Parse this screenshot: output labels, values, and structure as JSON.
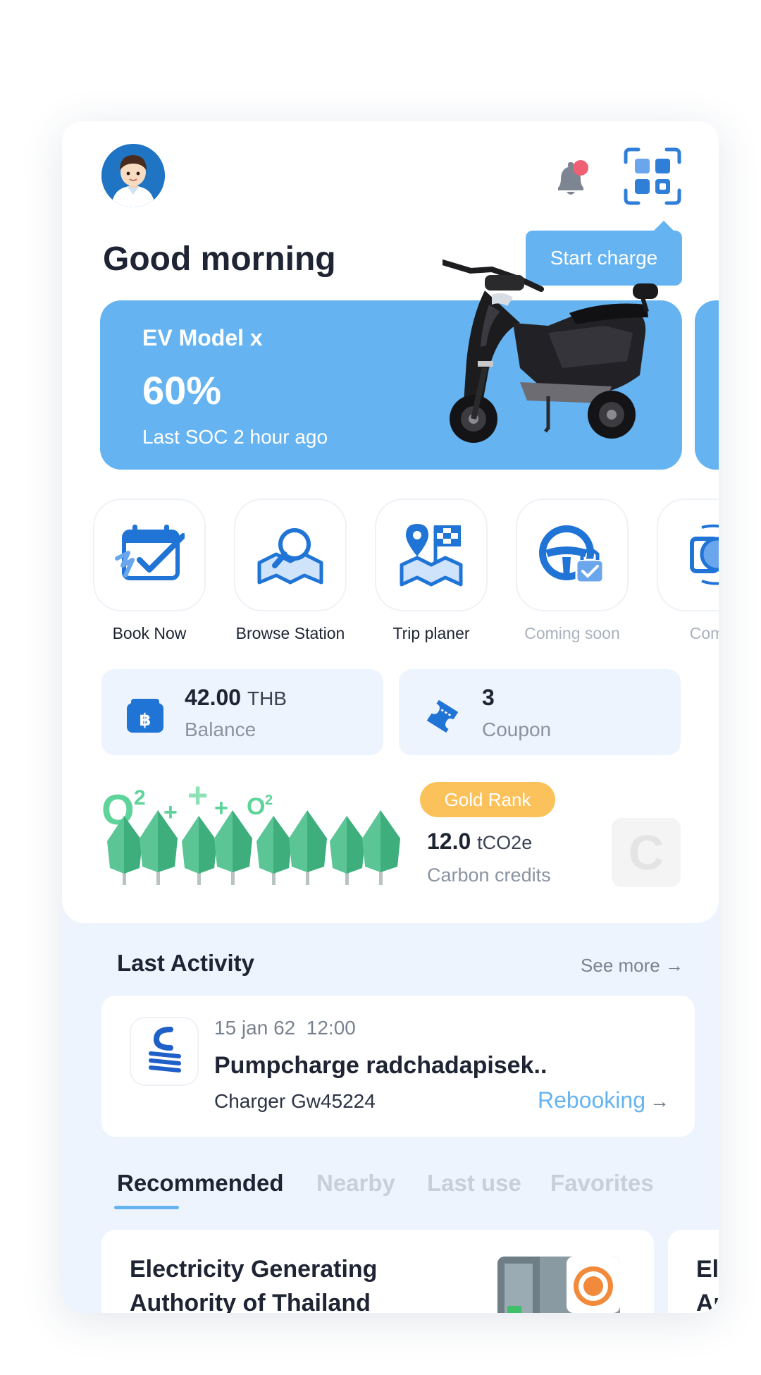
{
  "header": {
    "greeting": "Good morning",
    "tooltip": "Start charge",
    "avatar_icon": "user-avatar",
    "bell_icon": "bell-icon",
    "qr_icon": "qr-scan-icon"
  },
  "ev_card": {
    "model": "EV Model x",
    "soc": "60%",
    "last_update": "Last SOC 2 hour ago"
  },
  "quick_actions": [
    {
      "label": "Book Now",
      "icon": "calendar-check-icon"
    },
    {
      "label": "Browse Station",
      "icon": "map-search-icon"
    },
    {
      "label": "Trip planer",
      "icon": "trip-map-flag-icon"
    },
    {
      "label": "Coming soon",
      "icon": "steering-lock-icon"
    },
    {
      "label": "Comin",
      "icon": "partial-icon"
    }
  ],
  "balance": {
    "value": "42.00",
    "unit": "THB",
    "label": "Balance",
    "icon": "wallet-baht-icon"
  },
  "coupon": {
    "value": "3",
    "label": "Coupon",
    "icon": "ticket-icon"
  },
  "carbon": {
    "rank": "Gold Rank",
    "value": "12.0",
    "unit": "tCO2e",
    "label": "Carbon credits"
  },
  "last_activity": {
    "title": "Last Activity",
    "see_more": "See more",
    "date": "15 jan 62  12:00",
    "station": "Pumpcharge radchadapisek..",
    "charger": "Charger Gw45224",
    "action": "Rebooking"
  },
  "tabs": [
    "Recommended",
    "Nearby",
    "Last use",
    "Favorites"
  ],
  "recommended": {
    "title": "Electricity Generating Authority of Thailand",
    "peek_title_1": "El",
    "peek_title_2": "Au"
  },
  "colors": {
    "accent": "#65b3f1",
    "icon_blue": "#1f74d6",
    "gold": "#fbc25c",
    "text_dark": "#1e2433"
  }
}
